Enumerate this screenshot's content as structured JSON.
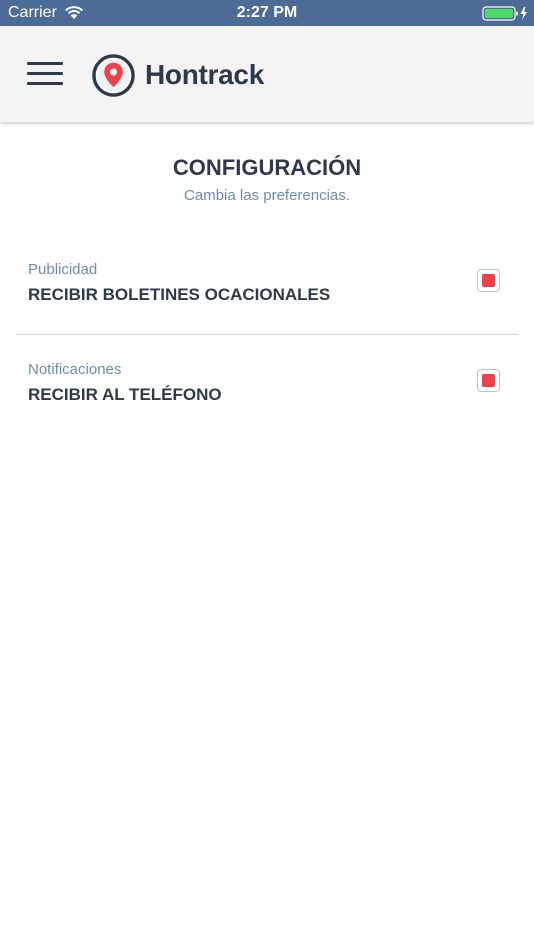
{
  "status_bar": {
    "carrier": "Carrier",
    "time": "2:27 PM",
    "icons": [
      "wifi-icon",
      "battery-icon",
      "charging-bolt-icon"
    ],
    "battery_level": 1.0,
    "background_color": "#4d6b97"
  },
  "header": {
    "brand_name": "Hontrack",
    "icons": [
      "menu-icon",
      "map-pin-logo-icon"
    ],
    "brand_accent_color": "#f0414b",
    "text_color": "#2e3a4c"
  },
  "page": {
    "title": "CONFIGURACIÓN",
    "subtitle": "Cambia las preferencias."
  },
  "settings": [
    {
      "category": "Publicidad",
      "label": "RECIBIR BOLETINES OCACIONALES",
      "checked": true
    },
    {
      "category": "Notificaciones",
      "label": "RECIBIR AL TELÉFONO",
      "checked": true
    }
  ],
  "colors": {
    "primary_text": "#2e3a4c",
    "secondary_text": "#6e8ab3",
    "checkbox_fill": "#f0414b",
    "divider": "#d4d4d4"
  }
}
